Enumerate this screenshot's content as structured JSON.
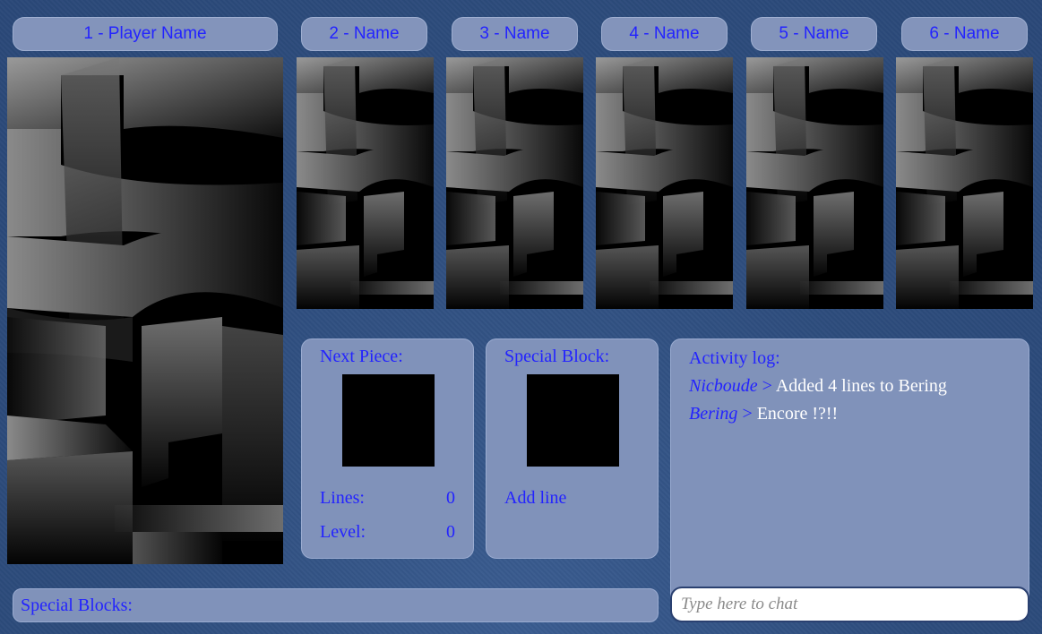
{
  "players": [
    {
      "label": "1 - Player Name"
    },
    {
      "label": "2 - Name"
    },
    {
      "label": "3 - Name"
    },
    {
      "label": "4 - Name"
    },
    {
      "label": "5 - Name"
    },
    {
      "label": "6 - Name"
    }
  ],
  "next_piece": {
    "title": "Next Piece:",
    "lines_label": "Lines:",
    "lines_value": "0",
    "level_label": "Level:",
    "level_value": "0"
  },
  "special_block": {
    "title": "Special Block:",
    "action_label": "Add line"
  },
  "activity_log": {
    "title": "Activity log:",
    "entries": [
      {
        "who": "Nicboude",
        "sep": " > ",
        "msg": "Added 4 lines to Bering"
      },
      {
        "who": "Bering",
        "sep": " > ",
        "msg": "Encore !?!!"
      }
    ]
  },
  "special_blocks_bar": {
    "label": "Special Blocks:"
  },
  "chat": {
    "placeholder": "Type here to chat"
  }
}
